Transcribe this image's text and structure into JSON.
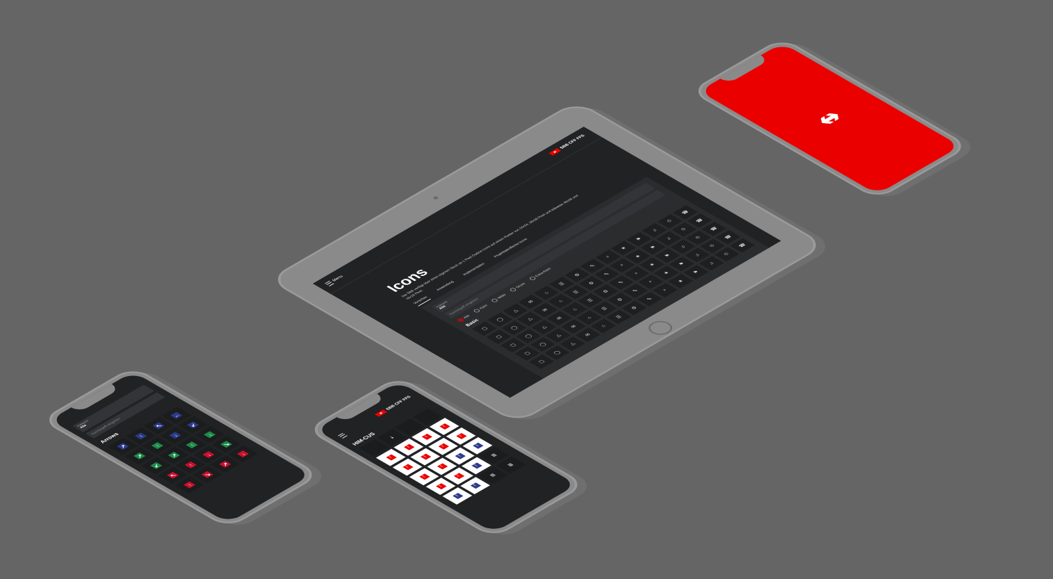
{
  "tablet": {
    "menu_label": "Menu",
    "brand": "SBB CFF FFS",
    "title": "Icons",
    "description": "Die SBB verfügt über einen eigenen Stock an 1 Pixel Outline Icons auf einem Raster von 24x24, 36x36 Pixel und teilweise 48x48 und 16x16 Pixel.",
    "tabs": [
      "Vorschau",
      "Anwendung",
      "Implementation",
      "Projektspezifische Icons"
    ],
    "select_label": "Kategorie",
    "select_value": "Alle",
    "search_placeholder": "Suchbegriff eingeben",
    "radios": [
      "Alle",
      "Klein",
      "Mittel",
      "Gross",
      "Extra-Klein"
    ],
    "section": "Basic"
  },
  "phone_left": {
    "select_label": "Kategorie",
    "select_value": "Alle",
    "search_placeholder": "Suchbegriff eingeben",
    "section": "Arrows",
    "colors": {
      "blue": "#2d3a8c",
      "green": "#1d8c4a",
      "red": "#c8102e"
    }
  },
  "phone_center": {
    "brand": "SBB CFF FFS",
    "section": "HIM-CUS"
  },
  "phone_red": {
    "logo": "sbb-logo-icon",
    "background": "#eb0000"
  }
}
